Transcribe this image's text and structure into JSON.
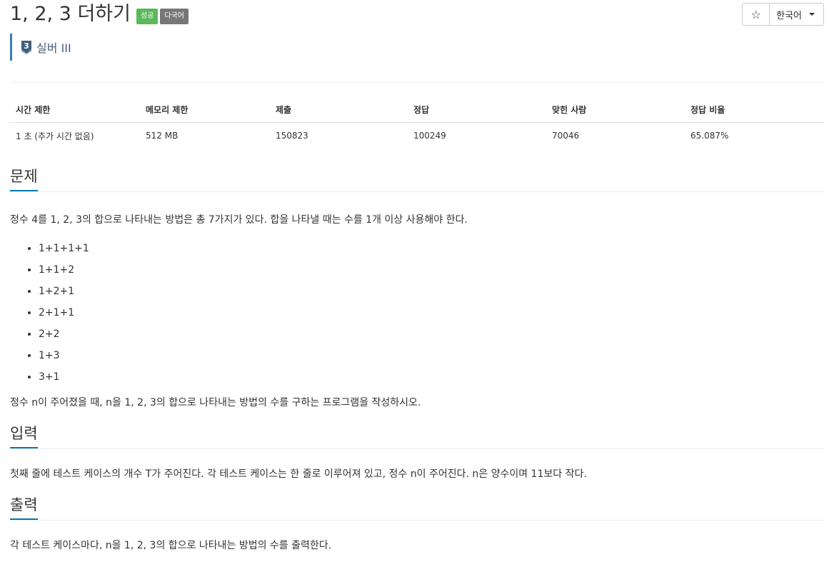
{
  "problem": {
    "title": "1, 2, 3 더하기",
    "labels": {
      "success": "성공",
      "multilang": "다국어"
    },
    "tier": {
      "number": "3",
      "name": "실버 III"
    }
  },
  "controls": {
    "star": "☆",
    "language": "한국어"
  },
  "stats": {
    "headers": [
      "시간 제한",
      "메모리 제한",
      "제출",
      "정답",
      "맞힌 사람",
      "정답 비율"
    ],
    "values": [
      "1 초 (추가 시간 없음)",
      "512 MB",
      "150823",
      "100249",
      "70046",
      "65.087%"
    ]
  },
  "sections": {
    "problem": {
      "heading": "문제",
      "intro": "정수 4를 1, 2, 3의 합으로 나타내는 방법은 총 7가지가 있다. 합을 나타낼 때는 수를 1개 이상 사용해야 한다.",
      "items": [
        "1+1+1+1",
        "1+1+2",
        "1+2+1",
        "2+1+1",
        "2+2",
        "1+3",
        "3+1"
      ],
      "outro": "정수 n이 주어졌을 때, n을 1, 2, 3의 합으로 나타내는 방법의 수를 구하는 프로그램을 작성하시오."
    },
    "input": {
      "heading": "입력",
      "text": "첫째 줄에 테스트 케이스의 개수 T가 주어진다. 각 테스트 케이스는 한 줄로 이루어져 있고, 정수 n이 주어진다. n은 양수이며 11보다 작다."
    },
    "output": {
      "heading": "출력",
      "text": "각 테스트 케이스마다, n을 1, 2, 3의 합으로 나타내는 방법의 수를 출력한다."
    }
  },
  "colors": {
    "success": "#5cb85c",
    "multilang": "#777777",
    "accent": "#0076c0",
    "tier": "#435f7a"
  }
}
